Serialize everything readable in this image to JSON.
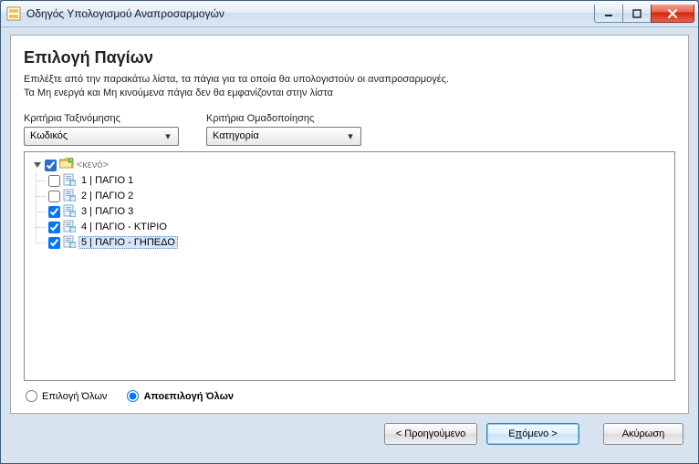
{
  "window": {
    "title": "Οδηγός Υπολογισμού Αναπροσαρμογών"
  },
  "page": {
    "title": "Επιλογή Παγίων",
    "instructions_line1": "Επιλέξτε από την παρακάτω λίστα, τα πάγια για τα οποία θα υπολογιστούν οι αναπροσαρμογές.",
    "instructions_line2": "Τα Μη ενεργά και Μη κινούμενα πάγια δεν θα εμφανίζονται στην λίστα"
  },
  "criteria": {
    "sort_label": "Κριτήρια Ταξινόμησης",
    "sort_value": "Κωδικός",
    "group_label": "Κριτήρια Ομαδοποίησης",
    "group_value": "Κατηγορία"
  },
  "tree": {
    "root_label": "<κενό>",
    "root_checked": true,
    "items": [
      {
        "code": "1",
        "name": "ΠΑΓΙΟ 1",
        "checked": false,
        "selected": false
      },
      {
        "code": "2",
        "name": "ΠΑΓΙΟ 2",
        "checked": false,
        "selected": false
      },
      {
        "code": "3",
        "name": "ΠΑΓΙΟ 3",
        "checked": true,
        "selected": false
      },
      {
        "code": "4",
        "name": "ΠΑΓΙΟ - ΚΤΙΡΙΟ",
        "checked": true,
        "selected": false
      },
      {
        "code": "5",
        "name": "ΠΑΓΙΟ - ΓΗΠΕΔΟ",
        "checked": true,
        "selected": true
      }
    ]
  },
  "radios": {
    "select_all": "Επιλογή Όλων",
    "deselect_all": "Αποεπιλογή Όλων",
    "active": "deselect"
  },
  "footer": {
    "prev": "< Προηγούμενο",
    "next_prefix": "Ε",
    "next_mnemonic": "π",
    "next_suffix": "όμενο >",
    "cancel": "Ακύρωση"
  }
}
